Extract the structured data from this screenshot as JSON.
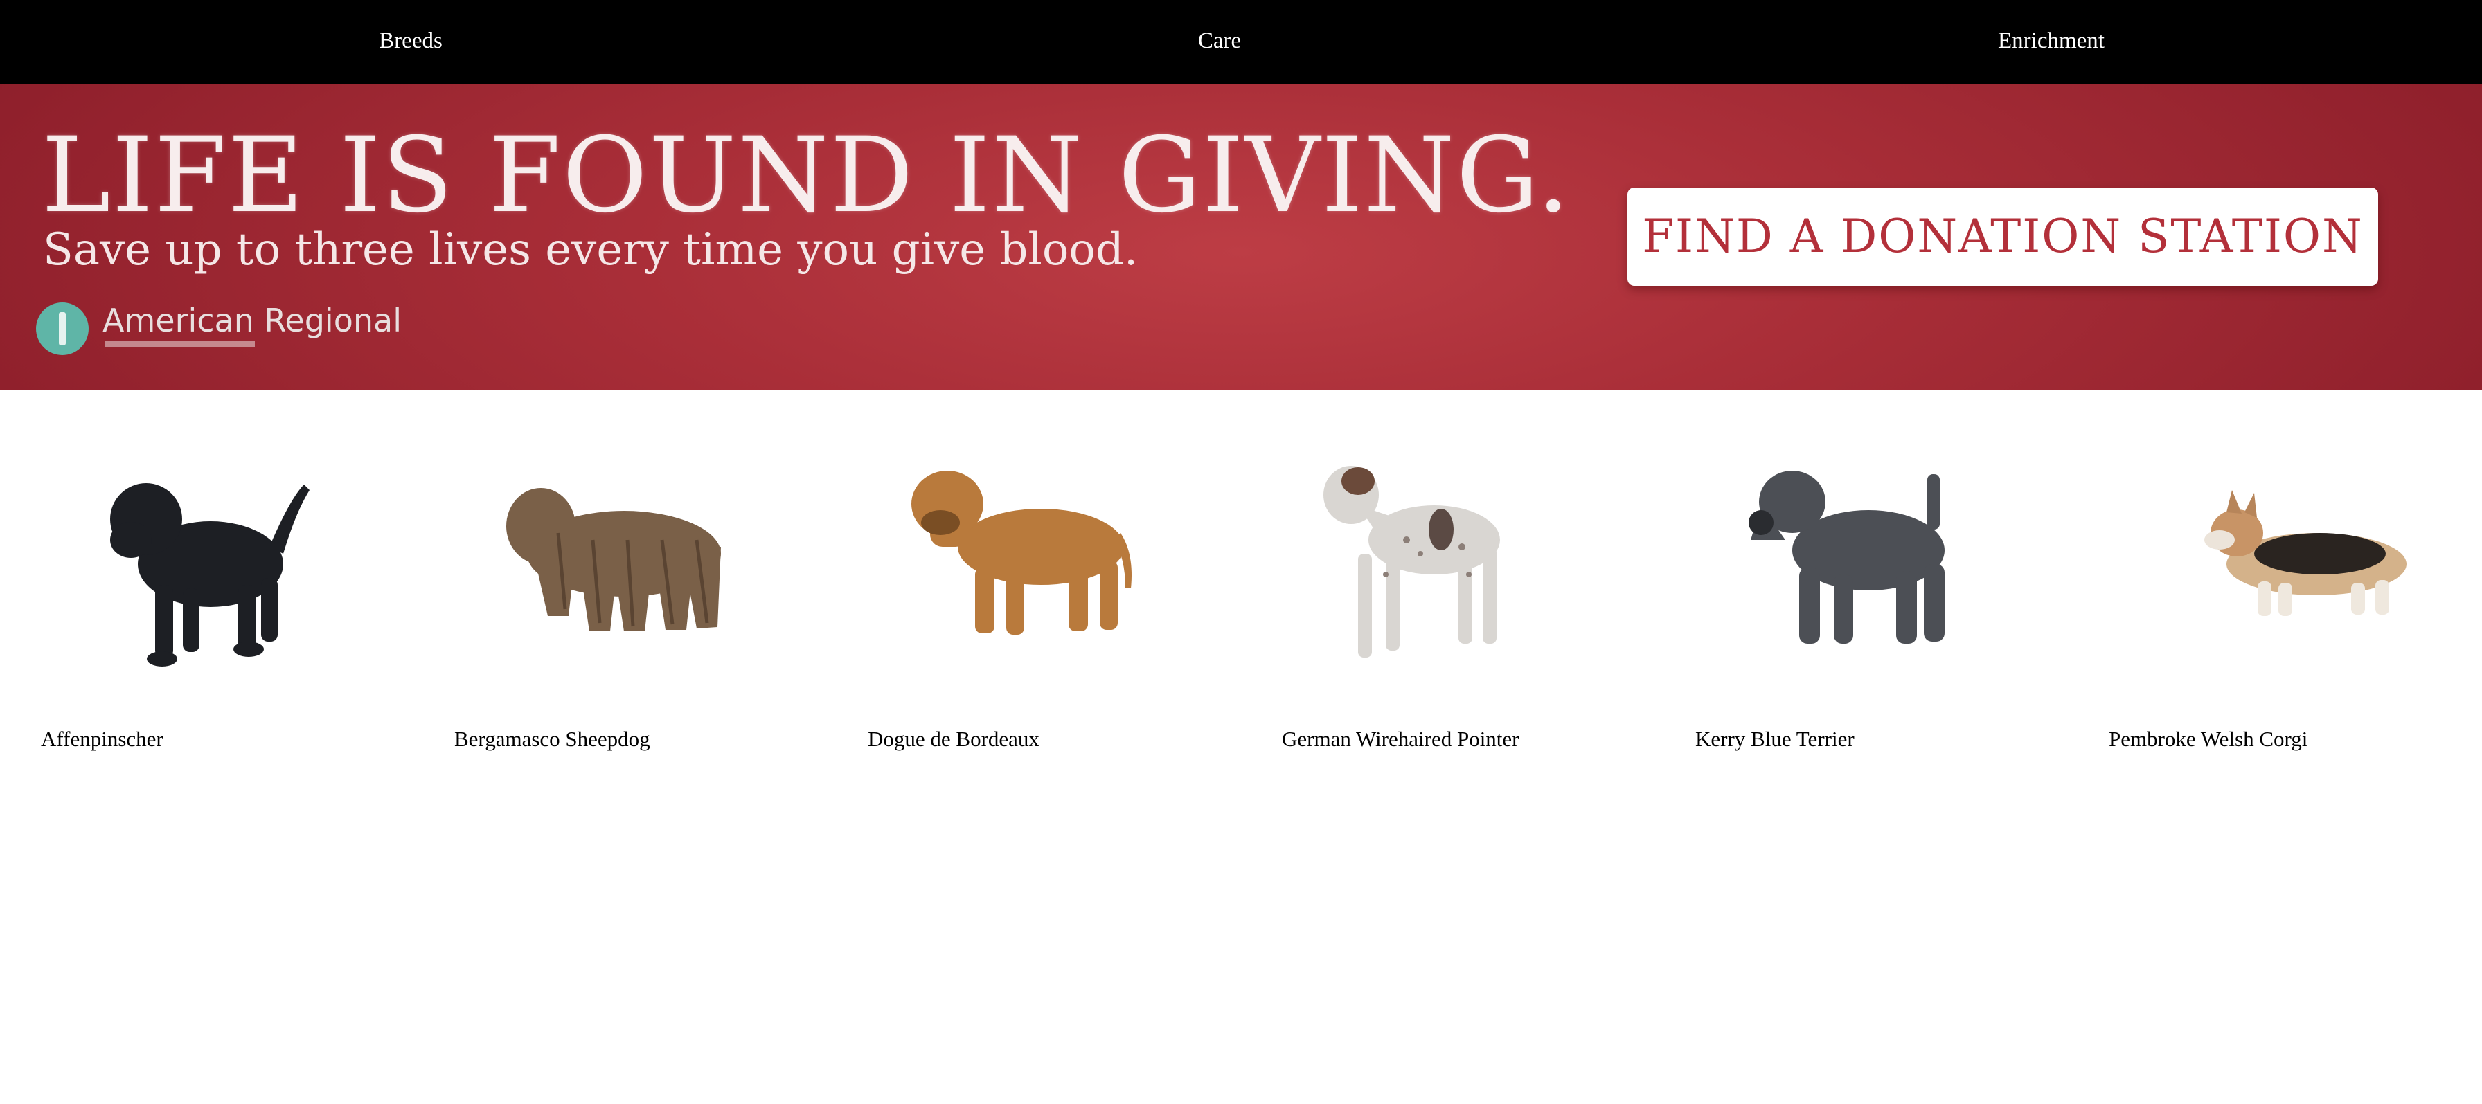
{
  "nav": {
    "items": [
      {
        "label": "Breeds"
      },
      {
        "label": "Care"
      },
      {
        "label": "Enrichment"
      }
    ]
  },
  "banner": {
    "headline": "LIFE IS FOUND IN GIVING.",
    "subline": "Save up to three lives every time you give blood.",
    "logo_text": "American Regional",
    "cta_label": "FIND A DONATION STATION",
    "colors": {
      "background": "#a92e38",
      "cta_text": "#b3303a",
      "logo": "#5fb5a7"
    }
  },
  "breeds": [
    {
      "name": "Affenpinscher",
      "image": "black-dog-photo",
      "color": "#1d1f24"
    },
    {
      "name": "Bergamasco Sheepdog",
      "image": "corded-brown-dog-photo",
      "color": "#7a6048"
    },
    {
      "name": "Dogue de Bordeaux",
      "image": "fawn-mastiff-photo",
      "color": "#b97a3c"
    },
    {
      "name": "German Wirehaired Pointer",
      "image": "white-ticked-pointer-photo",
      "color": "#d9d6d2"
    },
    {
      "name": "Kerry Blue Terrier",
      "image": "grey-terrier-photo",
      "color": "#4c4f55"
    },
    {
      "name": "Pembroke Welsh Corgi",
      "image": "tricolor-corgi-photo",
      "color": "#2a2420"
    }
  ]
}
